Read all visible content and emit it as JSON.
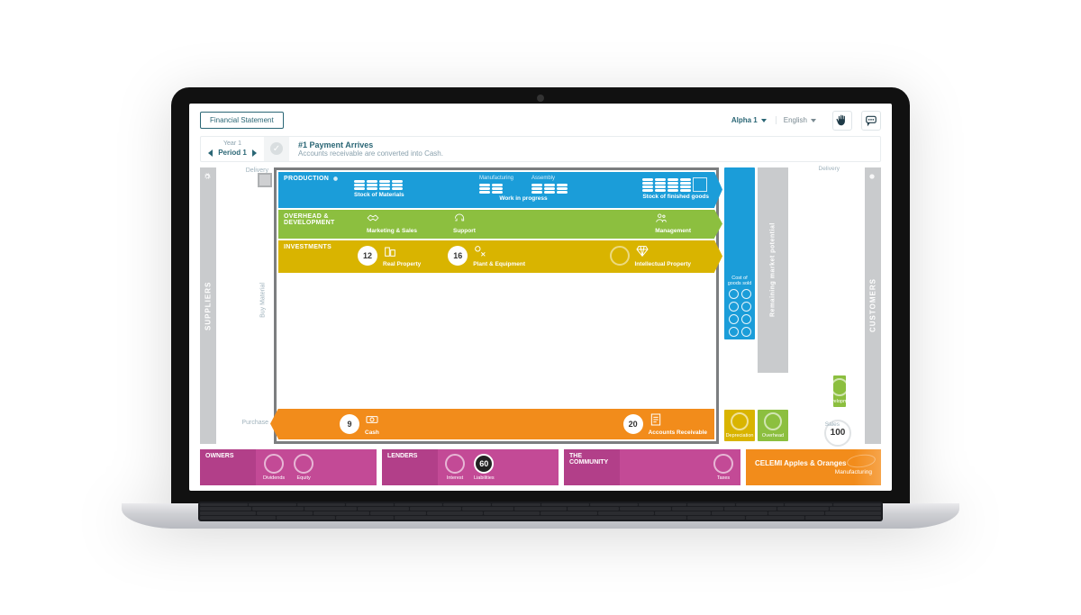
{
  "header": {
    "financial_statement_btn": "Financial Statement",
    "team": "Alpha 1",
    "language": "English"
  },
  "step": {
    "year": "Year 1",
    "period": "Period 1",
    "title": "#1 Payment Arrives",
    "subtitle": "Accounts receivable are converted into Cash."
  },
  "rails": {
    "left": "SUPPLIERS",
    "right": "CUSTOMERS"
  },
  "left_labels": {
    "delivery": "Delivery",
    "buy": "Buy Material",
    "purchase": "Purchase"
  },
  "production": {
    "title": "PRODUCTION",
    "stock_materials": "Stock of Materials",
    "manufacturing": "Manufacturing",
    "assembly": "Assembly",
    "work_in_progress": "Work in progress",
    "finished": "Stock of finished goods"
  },
  "overhead": {
    "title": "OVERHEAD & DEVELOPMENT",
    "marketing": "Marketing & Sales",
    "support": "Support",
    "management": "Management"
  },
  "investments": {
    "title": "INVESTMENTS",
    "real_property": {
      "value": "12",
      "label": "Real Property"
    },
    "plant": {
      "value": "16",
      "label": "Plant & Equipment"
    },
    "ip": {
      "label": "Intellectual Property"
    }
  },
  "cashrow": {
    "cash": {
      "value": "9",
      "label": "Cash"
    },
    "ar": {
      "value": "20",
      "label": "Accounts Receivable"
    }
  },
  "right": {
    "delivery": "Delivery",
    "sales": "Sales",
    "development": "Development",
    "overhead": "Overhead",
    "depreciation": "Depreciation",
    "cogs": "Cost of goods sold",
    "potential": "Remaining market potential",
    "badge": "100"
  },
  "bottom": {
    "owners": {
      "title": "OWNERS",
      "dividends": "Dividends",
      "equity": "Equity"
    },
    "lenders": {
      "title": "LENDERS",
      "interest": "Interest",
      "liabilities": "Liabilities",
      "liab_value": "60"
    },
    "community": {
      "title": "THE COMMUNITY",
      "taxes": "Taxes"
    }
  },
  "brand": {
    "name": "CELEMI Apples & Oranges",
    "edition": "Manufacturing"
  }
}
